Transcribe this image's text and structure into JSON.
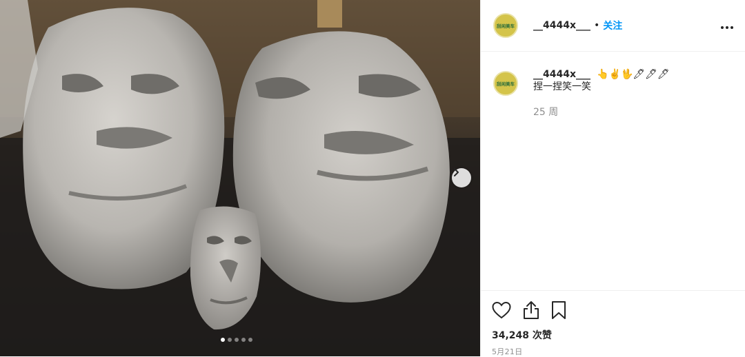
{
  "post": {
    "username": "__4444x___",
    "separator": "•",
    "follow_label": "关注",
    "avatar_text": "刮闲美车",
    "more_label": "•••",
    "carousel_dots": 5,
    "carousel_active": 0
  },
  "caption": {
    "username": "__4444x___",
    "emojis": "👆✌️🖖🖊🖊🖊",
    "text": "捏一捏笑一笑",
    "time": "25 周"
  },
  "actions": {
    "likes": "34,248 次赞",
    "date": "5月21日"
  },
  "icons": {
    "like": "heart-icon",
    "share": "share-icon",
    "save": "bookmark-icon",
    "next": "chevron-right-icon",
    "more": "more-options-icon"
  }
}
